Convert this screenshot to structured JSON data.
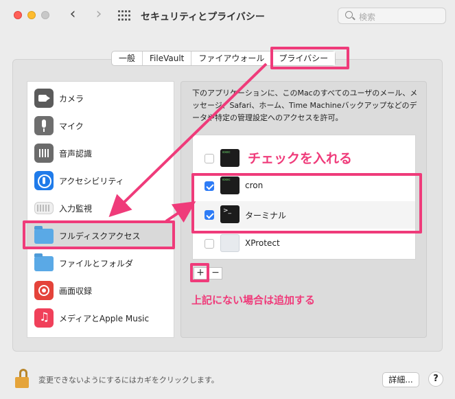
{
  "window": {
    "title": "セキュリティとプライバシー",
    "search_placeholder": "検索"
  },
  "tabs": [
    {
      "label": "一般"
    },
    {
      "label": "FileVault"
    },
    {
      "label": "ファイアウォール"
    },
    {
      "label": "プライバシー",
      "selected": true
    }
  ],
  "sidebar": {
    "items": [
      {
        "label": "カメラ",
        "icon": "camera-icon"
      },
      {
        "label": "マイク",
        "icon": "microphone-icon"
      },
      {
        "label": "音声認識",
        "icon": "speech-recognition-icon"
      },
      {
        "label": "アクセシビリティ",
        "icon": "accessibility-icon"
      },
      {
        "label": "入力監視",
        "icon": "keyboard-icon"
      },
      {
        "label": "フルディスクアクセス",
        "icon": "folder-icon",
        "selected": true
      },
      {
        "label": "ファイルとフォルダ",
        "icon": "folder-icon"
      },
      {
        "label": "画面収録",
        "icon": "screen-record-icon"
      },
      {
        "label": "メディアとApple Music",
        "icon": "music-icon"
      }
    ]
  },
  "main": {
    "description": "下のアプリケーションに、このMacのすべてのユーザのメール、メッセージ、Safari、ホーム、Time Machineバックアップなどのデータや特定の管理設定へのアクセスを許可。",
    "apps": [
      {
        "name": "",
        "checked": false,
        "icon": "terminal-exec-icon"
      },
      {
        "name": "cron",
        "checked": true,
        "icon": "cron-exec-icon"
      },
      {
        "name": "ターミナル",
        "checked": true,
        "icon": "terminal-icon"
      },
      {
        "name": "XProtect",
        "checked": false,
        "icon": "xprotect-icon"
      }
    ],
    "add_label": "+",
    "remove_label": "−"
  },
  "footer": {
    "lock_text": "変更できないようにするにはカギをクリックします。",
    "details_label": "詳細...",
    "help_label": "?"
  },
  "annotations": {
    "check_text": "チェックを入れる",
    "add_text": "上記にない場合は追加する",
    "highlight_color": "#ef3b7a"
  }
}
